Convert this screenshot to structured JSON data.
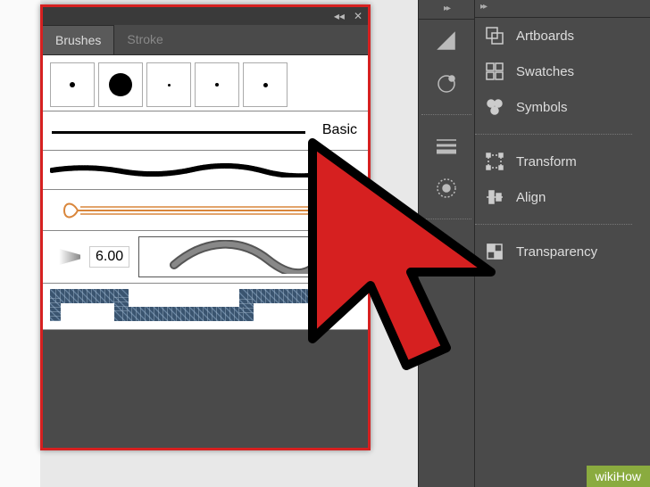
{
  "tabs": {
    "brushes": "Brushes",
    "stroke": "Stroke"
  },
  "brushes": {
    "default_name": "Basic",
    "width_value": "6.00"
  },
  "right_panel": {
    "items": [
      {
        "label": "Artboards"
      },
      {
        "label": "Swatches"
      },
      {
        "label": "Symbols"
      },
      {
        "label": "Transform"
      },
      {
        "label": "Align"
      },
      {
        "label": "Transparency"
      }
    ]
  },
  "watermark": "wikiHow"
}
